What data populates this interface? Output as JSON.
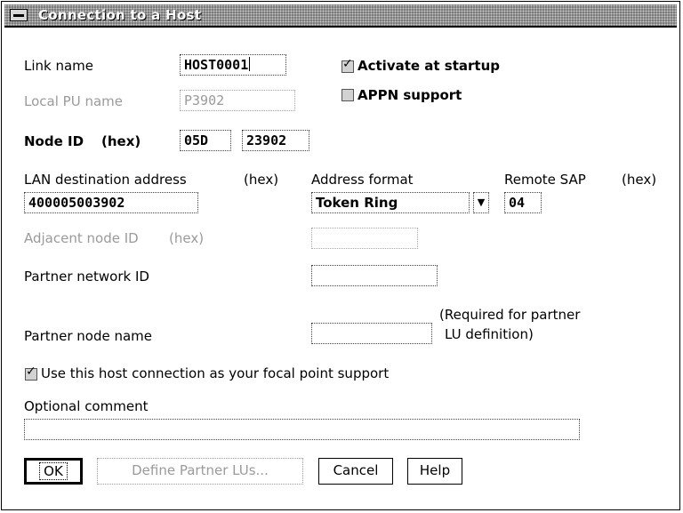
{
  "window": {
    "title": "Connection to a Host"
  },
  "link_name": {
    "label": "Link name",
    "value": "HOST0001"
  },
  "local_pu_name": {
    "label": "Local PU name",
    "value": "P3902"
  },
  "node_id": {
    "label": "Node ID",
    "hex_label": "(hex)",
    "value1": "05D",
    "value2": "23902"
  },
  "activate_at_startup": {
    "label": "Activate at startup",
    "checked": true
  },
  "appn_support": {
    "label": "APPN support",
    "checked": false
  },
  "lan_destination": {
    "label": "LAN destination address",
    "hex_label": "(hex)",
    "value": "400005003902"
  },
  "address_format": {
    "label": "Address format",
    "value": "Token Ring"
  },
  "remote_sap": {
    "label": "Remote SAP",
    "hex_label": "(hex)",
    "value": "04"
  },
  "adjacent_node_id": {
    "label": "Adjacent node ID",
    "hex_label": "(hex)",
    "value": ""
  },
  "partner_network_id": {
    "label": "Partner network ID",
    "value": ""
  },
  "partner_node_name": {
    "label": "Partner node name",
    "value": "",
    "note_line1": "(Required for partner",
    "note_line2": "LU definition)"
  },
  "focal_point": {
    "label": "Use this host connection as your focal point support",
    "checked": true
  },
  "optional_comment": {
    "label": "Optional comment",
    "value": ""
  },
  "buttons": {
    "ok": "OK",
    "define_partner": "Define Partner LUs...",
    "cancel": "Cancel",
    "help": "Help"
  }
}
